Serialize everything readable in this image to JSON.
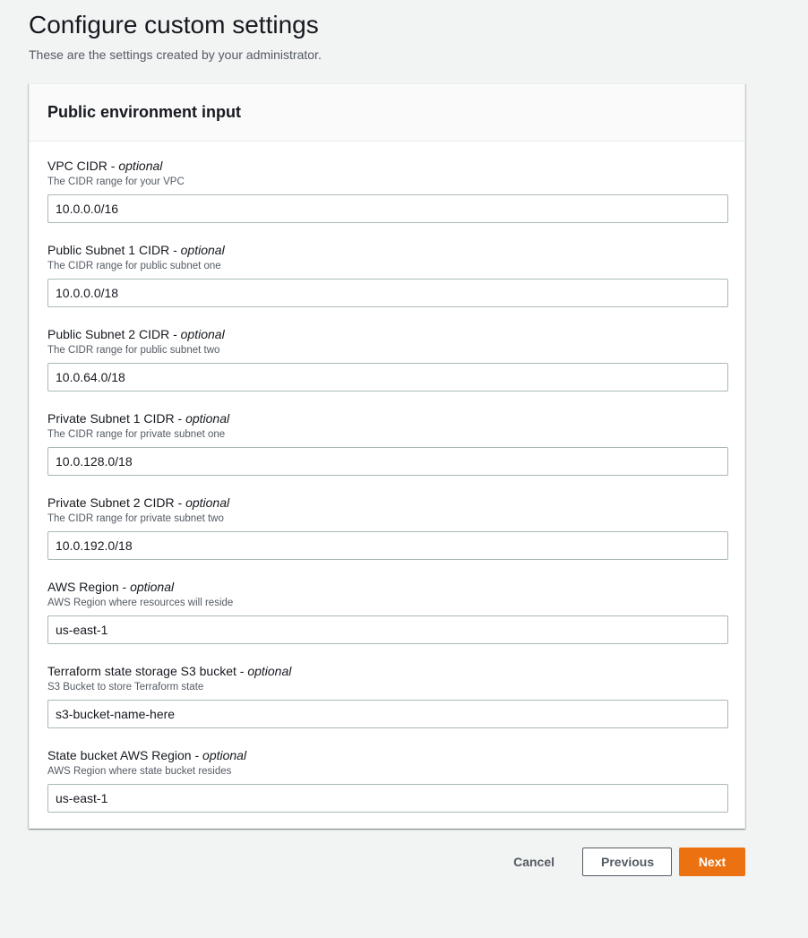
{
  "header": {
    "title": "Configure custom settings",
    "subtitle": "These are the settings created by your administrator."
  },
  "panel": {
    "title": "Public environment input",
    "optional_suffix": "optional",
    "fields": [
      {
        "label": "VPC CIDR",
        "description": "The CIDR range for your VPC",
        "value": "10.0.0.0/16"
      },
      {
        "label": "Public Subnet 1 CIDR",
        "description": "The CIDR range for public subnet one",
        "value": "10.0.0.0/18"
      },
      {
        "label": "Public Subnet 2 CIDR",
        "description": "The CIDR range for public subnet two",
        "value": "10.0.64.0/18"
      },
      {
        "label": "Private Subnet 1 CIDR",
        "description": "The CIDR range for private subnet one",
        "value": "10.0.128.0/18"
      },
      {
        "label": "Private Subnet 2 CIDR",
        "description": "The CIDR range for private subnet two",
        "value": "10.0.192.0/18"
      },
      {
        "label": "AWS Region",
        "description": "AWS Region where resources will reside",
        "value": "us-east-1"
      },
      {
        "label": "Terraform state storage S3 bucket",
        "description": "S3 Bucket to store Terraform state",
        "value": "s3-bucket-name-here"
      },
      {
        "label": "State bucket AWS Region",
        "description": "AWS Region where state bucket resides",
        "value": "us-east-1"
      }
    ]
  },
  "actions": {
    "cancel_label": "Cancel",
    "previous_label": "Previous",
    "next_label": "Next"
  },
  "colors": {
    "primary": "#ec7211",
    "background": "#f2f3f3",
    "text": "#16191f",
    "secondary_text": "#545b64"
  }
}
